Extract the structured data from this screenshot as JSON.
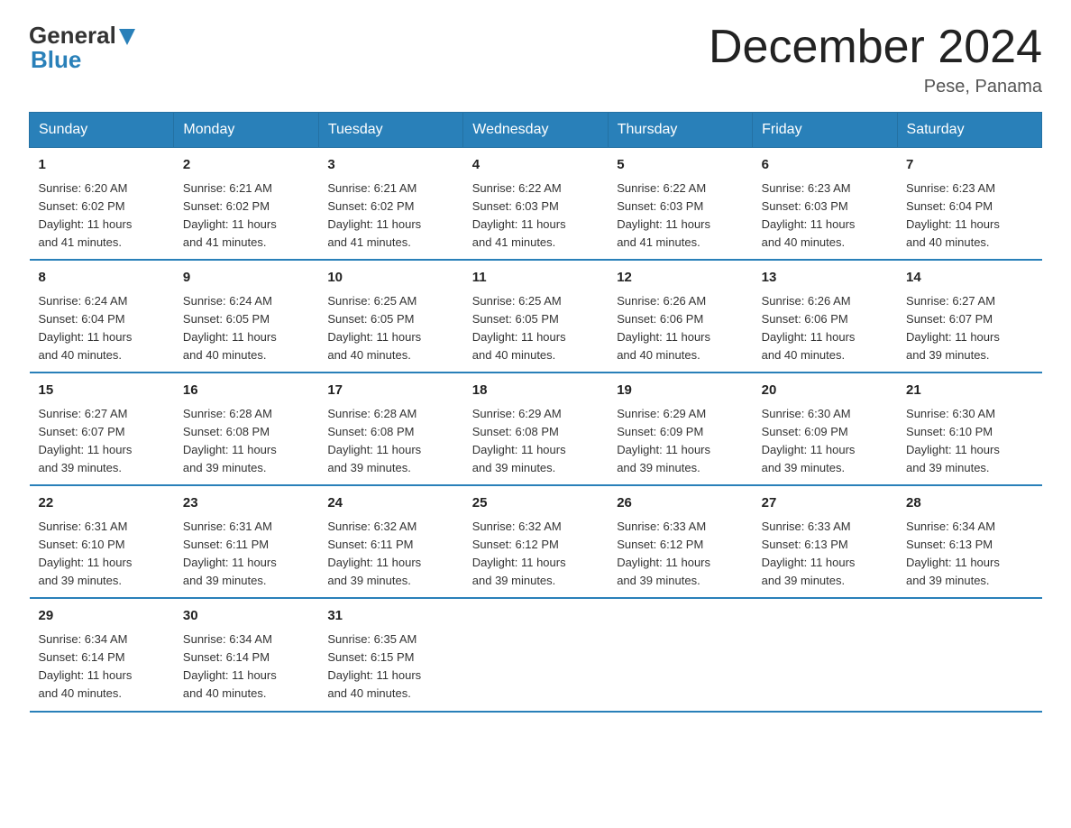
{
  "logo": {
    "text_general": "General",
    "text_blue": "Blue"
  },
  "title": "December 2024",
  "location": "Pese, Panama",
  "days_of_week": [
    "Sunday",
    "Monday",
    "Tuesday",
    "Wednesday",
    "Thursday",
    "Friday",
    "Saturday"
  ],
  "weeks": [
    [
      {
        "day": "1",
        "sunrise": "6:20 AM",
        "sunset": "6:02 PM",
        "daylight": "11 hours and 41 minutes."
      },
      {
        "day": "2",
        "sunrise": "6:21 AM",
        "sunset": "6:02 PM",
        "daylight": "11 hours and 41 minutes."
      },
      {
        "day": "3",
        "sunrise": "6:21 AM",
        "sunset": "6:02 PM",
        "daylight": "11 hours and 41 minutes."
      },
      {
        "day": "4",
        "sunrise": "6:22 AM",
        "sunset": "6:03 PM",
        "daylight": "11 hours and 41 minutes."
      },
      {
        "day": "5",
        "sunrise": "6:22 AM",
        "sunset": "6:03 PM",
        "daylight": "11 hours and 41 minutes."
      },
      {
        "day": "6",
        "sunrise": "6:23 AM",
        "sunset": "6:03 PM",
        "daylight": "11 hours and 40 minutes."
      },
      {
        "day": "7",
        "sunrise": "6:23 AM",
        "sunset": "6:04 PM",
        "daylight": "11 hours and 40 minutes."
      }
    ],
    [
      {
        "day": "8",
        "sunrise": "6:24 AM",
        "sunset": "6:04 PM",
        "daylight": "11 hours and 40 minutes."
      },
      {
        "day": "9",
        "sunrise": "6:24 AM",
        "sunset": "6:05 PM",
        "daylight": "11 hours and 40 minutes."
      },
      {
        "day": "10",
        "sunrise": "6:25 AM",
        "sunset": "6:05 PM",
        "daylight": "11 hours and 40 minutes."
      },
      {
        "day": "11",
        "sunrise": "6:25 AM",
        "sunset": "6:05 PM",
        "daylight": "11 hours and 40 minutes."
      },
      {
        "day": "12",
        "sunrise": "6:26 AM",
        "sunset": "6:06 PM",
        "daylight": "11 hours and 40 minutes."
      },
      {
        "day": "13",
        "sunrise": "6:26 AM",
        "sunset": "6:06 PM",
        "daylight": "11 hours and 40 minutes."
      },
      {
        "day": "14",
        "sunrise": "6:27 AM",
        "sunset": "6:07 PM",
        "daylight": "11 hours and 39 minutes."
      }
    ],
    [
      {
        "day": "15",
        "sunrise": "6:27 AM",
        "sunset": "6:07 PM",
        "daylight": "11 hours and 39 minutes."
      },
      {
        "day": "16",
        "sunrise": "6:28 AM",
        "sunset": "6:08 PM",
        "daylight": "11 hours and 39 minutes."
      },
      {
        "day": "17",
        "sunrise": "6:28 AM",
        "sunset": "6:08 PM",
        "daylight": "11 hours and 39 minutes."
      },
      {
        "day": "18",
        "sunrise": "6:29 AM",
        "sunset": "6:08 PM",
        "daylight": "11 hours and 39 minutes."
      },
      {
        "day": "19",
        "sunrise": "6:29 AM",
        "sunset": "6:09 PM",
        "daylight": "11 hours and 39 minutes."
      },
      {
        "day": "20",
        "sunrise": "6:30 AM",
        "sunset": "6:09 PM",
        "daylight": "11 hours and 39 minutes."
      },
      {
        "day": "21",
        "sunrise": "6:30 AM",
        "sunset": "6:10 PM",
        "daylight": "11 hours and 39 minutes."
      }
    ],
    [
      {
        "day": "22",
        "sunrise": "6:31 AM",
        "sunset": "6:10 PM",
        "daylight": "11 hours and 39 minutes."
      },
      {
        "day": "23",
        "sunrise": "6:31 AM",
        "sunset": "6:11 PM",
        "daylight": "11 hours and 39 minutes."
      },
      {
        "day": "24",
        "sunrise": "6:32 AM",
        "sunset": "6:11 PM",
        "daylight": "11 hours and 39 minutes."
      },
      {
        "day": "25",
        "sunrise": "6:32 AM",
        "sunset": "6:12 PM",
        "daylight": "11 hours and 39 minutes."
      },
      {
        "day": "26",
        "sunrise": "6:33 AM",
        "sunset": "6:12 PM",
        "daylight": "11 hours and 39 minutes."
      },
      {
        "day": "27",
        "sunrise": "6:33 AM",
        "sunset": "6:13 PM",
        "daylight": "11 hours and 39 minutes."
      },
      {
        "day": "28",
        "sunrise": "6:34 AM",
        "sunset": "6:13 PM",
        "daylight": "11 hours and 39 minutes."
      }
    ],
    [
      {
        "day": "29",
        "sunrise": "6:34 AM",
        "sunset": "6:14 PM",
        "daylight": "11 hours and 40 minutes."
      },
      {
        "day": "30",
        "sunrise": "6:34 AM",
        "sunset": "6:14 PM",
        "daylight": "11 hours and 40 minutes."
      },
      {
        "day": "31",
        "sunrise": "6:35 AM",
        "sunset": "6:15 PM",
        "daylight": "11 hours and 40 minutes."
      },
      {
        "day": "",
        "sunrise": "",
        "sunset": "",
        "daylight": ""
      },
      {
        "day": "",
        "sunrise": "",
        "sunset": "",
        "daylight": ""
      },
      {
        "day": "",
        "sunrise": "",
        "sunset": "",
        "daylight": ""
      },
      {
        "day": "",
        "sunrise": "",
        "sunset": "",
        "daylight": ""
      }
    ]
  ],
  "labels": {
    "sunrise": "Sunrise:",
    "sunset": "Sunset:",
    "daylight": "Daylight:"
  }
}
